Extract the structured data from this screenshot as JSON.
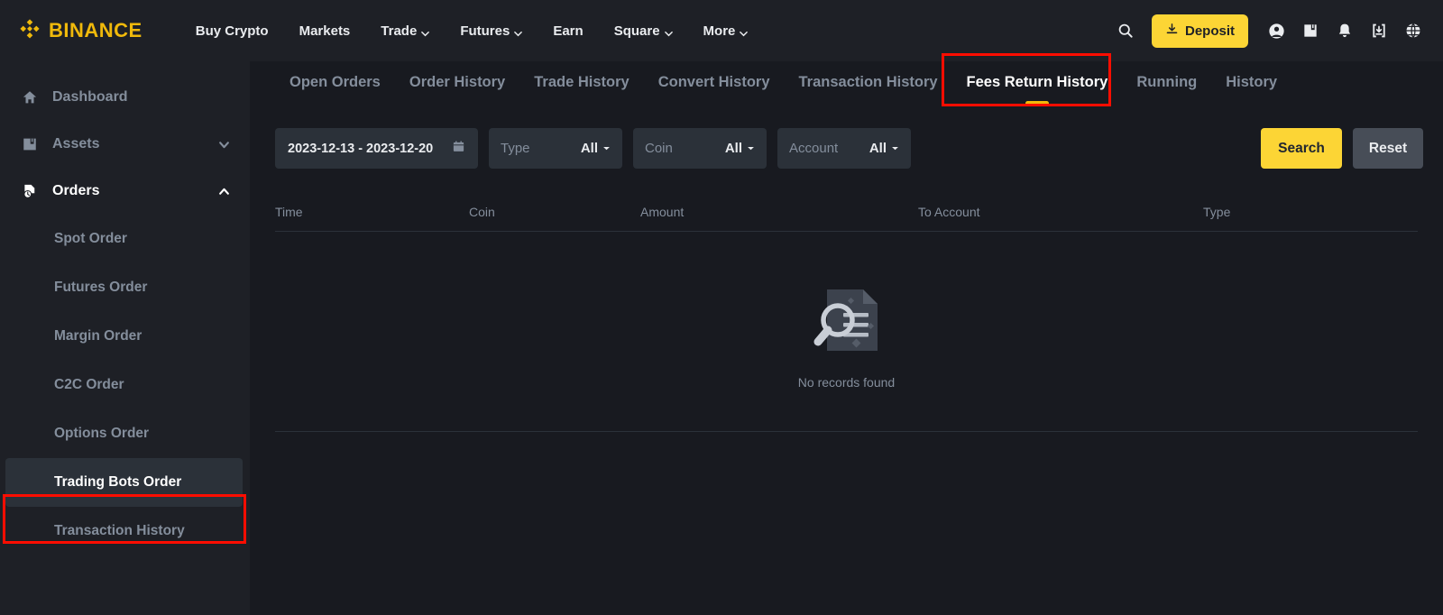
{
  "brand": {
    "name": "BINANCE",
    "logo_icon": "binance-diamond-logo",
    "color": "#F0B90B"
  },
  "topnav": {
    "links": [
      {
        "label": "Buy Crypto",
        "has_caret": false
      },
      {
        "label": "Markets",
        "has_caret": false
      },
      {
        "label": "Trade",
        "has_caret": true
      },
      {
        "label": "Futures",
        "has_caret": true
      },
      {
        "label": "Earn",
        "has_caret": false
      },
      {
        "label": "Square",
        "has_caret": true
      },
      {
        "label": "More",
        "has_caret": true
      }
    ],
    "search_icon": "search-icon",
    "deposit_label": "Deposit",
    "deposit_icon": "download-icon",
    "right_icons": [
      "user-profile-icon",
      "wallet-icon",
      "bell-icon",
      "download-app-icon",
      "globe-language-icon"
    ]
  },
  "sidebar": {
    "items": [
      {
        "label": "Dashboard",
        "icon": "home-icon",
        "expandable": false,
        "active": false
      },
      {
        "label": "Assets",
        "icon": "wallet-icon",
        "expandable": true,
        "expanded": false,
        "chevron": "chevron-down-icon",
        "active": false
      },
      {
        "label": "Orders",
        "icon": "orders-clock-icon",
        "expandable": true,
        "expanded": true,
        "chevron": "chevron-up-icon",
        "active": true
      }
    ],
    "sub_items": [
      {
        "label": "Spot Order",
        "selected": false
      },
      {
        "label": "Futures Order",
        "selected": false
      },
      {
        "label": "Margin Order",
        "selected": false
      },
      {
        "label": "C2C Order",
        "selected": false
      },
      {
        "label": "Options Order",
        "selected": false
      },
      {
        "label": "Trading Bots Order",
        "selected": true
      },
      {
        "label": "Transaction History",
        "selected": false
      }
    ]
  },
  "tabs": [
    {
      "label": "Open Orders",
      "active": false
    },
    {
      "label": "Order History",
      "active": false
    },
    {
      "label": "Trade History",
      "active": false
    },
    {
      "label": "Convert History",
      "active": false
    },
    {
      "label": "Transaction History",
      "active": false
    },
    {
      "label": "Fees Return History",
      "active": true
    },
    {
      "label": "Running",
      "active": false
    },
    {
      "label": "History",
      "active": false
    }
  ],
  "filters": {
    "date_range": "2023-12-13 - 2023-12-20",
    "calendar_icon": "calendar-icon",
    "type": {
      "label": "Type",
      "value": "All"
    },
    "coin": {
      "label": "Coin",
      "value": "All"
    },
    "account": {
      "label": "Account",
      "value": "All"
    },
    "search_label": "Search",
    "reset_label": "Reset"
  },
  "table": {
    "columns": [
      "Time",
      "Coin",
      "Amount",
      "To Account",
      "Type"
    ],
    "rows": [],
    "empty_text": "No records found",
    "empty_icon": "no-records-document-search-icon"
  },
  "annotations": [
    {
      "target": "tab-fees-return-history",
      "color": "#FF0D00"
    },
    {
      "target": "sidebar-item-trading-bots-order",
      "color": "#FF0D00"
    }
  ]
}
